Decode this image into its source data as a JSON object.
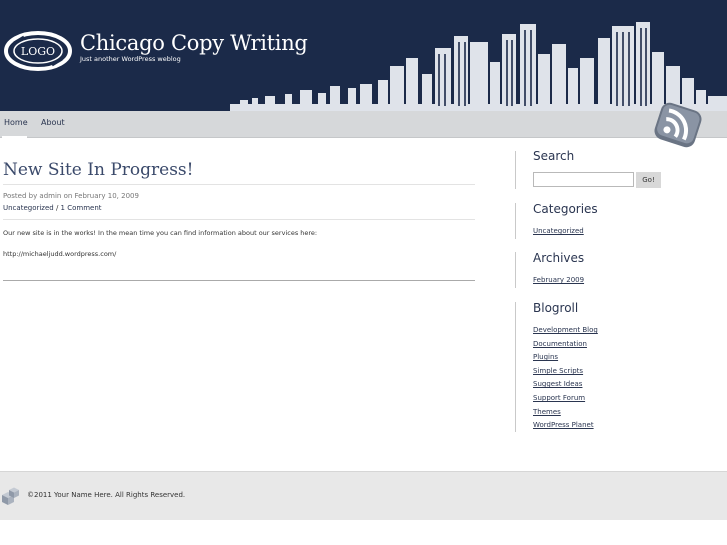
{
  "header": {
    "logo_text": "LOGO",
    "title": "Chicago Copy Writing",
    "tagline": "Just another WordPress weblog"
  },
  "nav": {
    "items": [
      {
        "label": "Home"
      },
      {
        "label": "About"
      }
    ]
  },
  "post": {
    "title": "New Site In Progress!",
    "meta": "Posted by admin on February 10, 2009",
    "category": "Uncategorized",
    "separator": " / ",
    "comments": "1 Comment",
    "body": "Our new site is in the works!  In the mean time you can find information about our services here:",
    "link": "http://michaeljudd.wordpress.com/"
  },
  "sidebar": {
    "search": {
      "heading": "Search",
      "placeholder": "",
      "button": "Go!"
    },
    "categories": {
      "heading": "Categories",
      "items": [
        "Uncategorized"
      ]
    },
    "archives": {
      "heading": "Archives",
      "items": [
        "February 2009"
      ]
    },
    "blogroll": {
      "heading": "Blogroll",
      "items": [
        "Development Blog",
        "Documentation",
        "Plugins",
        "Simple Scripts",
        "Suggest Ideas",
        "Support Forum",
        "Themes",
        "WordPress Planet"
      ]
    }
  },
  "footer": {
    "text": "©2011 Your Name Here. All Rights Reserved."
  },
  "colors": {
    "header_bg": "#1b2a49",
    "nav_bg": "#d6d8da",
    "link": "#2a3550",
    "footer_bg": "#e8e8e8"
  },
  "icons": [
    "logo-icon",
    "skyline-illustration",
    "rss-icon",
    "footer-cube-icon"
  ]
}
